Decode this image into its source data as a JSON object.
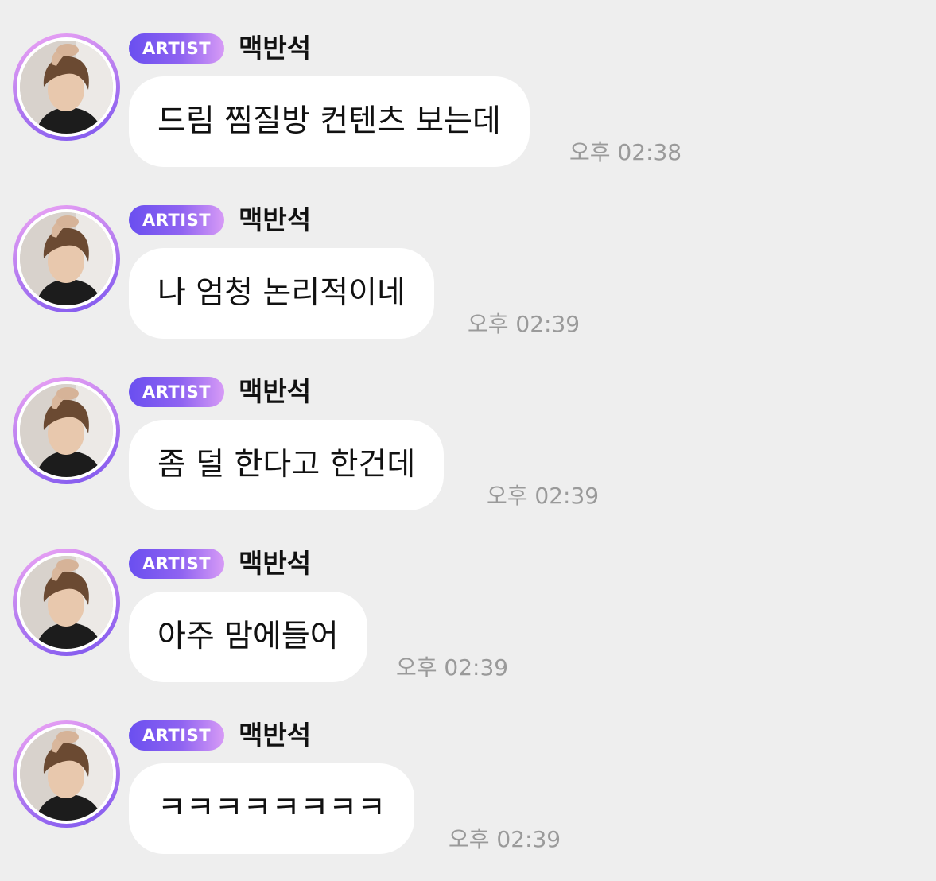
{
  "messages": [
    {
      "badge": "ARTIST",
      "sender": "맥반석",
      "text": "드림 찜질방 컨텐츠 보는데",
      "time": "오후 02:38"
    },
    {
      "badge": "ARTIST",
      "sender": "맥반석",
      "text": "나 엄청 논리적이네",
      "time": "오후 02:39"
    },
    {
      "badge": "ARTIST",
      "sender": "맥반석",
      "text": "좀 덜 한다고 한건데",
      "time": "오후 02:39"
    },
    {
      "badge": "ARTIST",
      "sender": "맥반석",
      "text": "아주 맘에들어",
      "time": "오후 02:39"
    },
    {
      "badge": "ARTIST",
      "sender": "맥반석",
      "text": "ㅋㅋㅋㅋㅋㅋㅋㅋ",
      "time": "오후 02:39"
    }
  ],
  "colors": {
    "background": "#eeeeee",
    "bubble": "#ffffff",
    "badge_start": "#6a4ff0",
    "badge_end": "#d79bf6",
    "timestamp": "#9a9a9a"
  },
  "icons": {
    "avatar": "artist-profile-photo"
  }
}
